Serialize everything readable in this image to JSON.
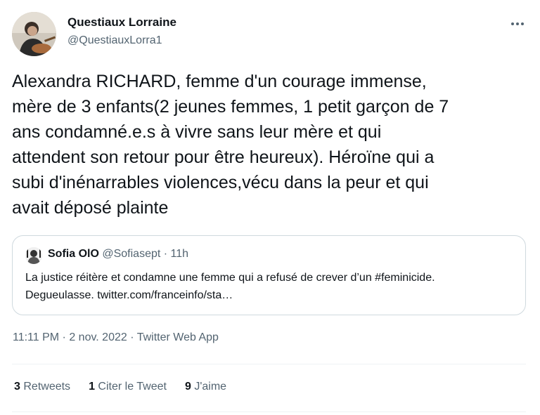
{
  "author": {
    "display_name": "Questiaux Lorraine",
    "handle": "@QuestiauxLorra1"
  },
  "tweet": {
    "text": "Alexandra RICHARD, femme d'un courage immense,\nmère de 3 enfants(2 jeunes femmes, 1 petit garçon de 7\nans condamné.e.s à vivre sans leur mère et qui\nattendent son retour pour être heureux). Héroïne qui a\nsubi d'inénarrables violences,vécu dans la peur et qui\navait déposé plainte"
  },
  "quote": {
    "name": "Sofia OlO",
    "meta": "@Sofiasept · 11h",
    "text": "La justice réitère et condamne une femme qui a refusé de crever d’un #feminicide.\nDegueulasse. twitter.com/franceinfo/sta…"
  },
  "timestamp": {
    "time": "11:11 PM",
    "separator1": " · ",
    "date": "2 nov. 2022",
    "separator2": " · ",
    "source": "Twitter Web App"
  },
  "stats": {
    "retweets": {
      "count": "3",
      "label": "Retweets"
    },
    "quotes": {
      "count": "1",
      "label": "Citer le Tweet"
    },
    "likes": {
      "count": "9",
      "label": "J'aime"
    }
  },
  "icons": {
    "more": "more-horizontal-icon"
  },
  "colors": {
    "text_primary": "#0f1419",
    "text_secondary": "#536471",
    "border": "#cfd9de",
    "divider": "#eff3f4"
  }
}
